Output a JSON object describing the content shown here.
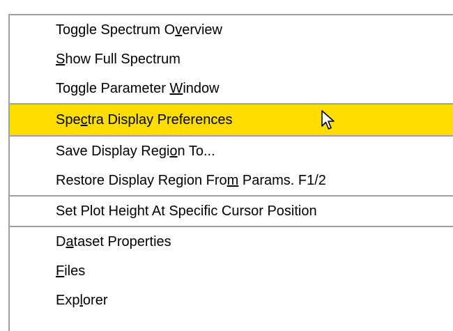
{
  "menu": {
    "items": [
      {
        "pre": "Toggle Spectrum O",
        "mn": "v",
        "post": "erview"
      },
      {
        "pre": "",
        "mn": "S",
        "post": "how Full Spectrum"
      },
      {
        "pre": "Toggle Parameter ",
        "mn": "W",
        "post": "indow"
      },
      {
        "pre": "Spe",
        "mn": "c",
        "post": "tra Display Preferences",
        "highlighted": true
      },
      {
        "pre": "Save Display Regi",
        "mn": "o",
        "post": "n To..."
      },
      {
        "pre": "Restore Display Region Fro",
        "mn": "m",
        "post": " Params. F1/2"
      },
      {
        "pre": "Set Plot Height At Specific Cursor Position",
        "mn": "",
        "post": ""
      },
      {
        "pre": "D",
        "mn": "a",
        "post": "taset Properties"
      },
      {
        "pre": "",
        "mn": "F",
        "post": "iles"
      },
      {
        "pre": "Exp",
        "mn": "l",
        "post": "orer"
      }
    ],
    "highlight_color": "#ffdd00"
  },
  "cursor_icon": "arrow-pointer-icon"
}
